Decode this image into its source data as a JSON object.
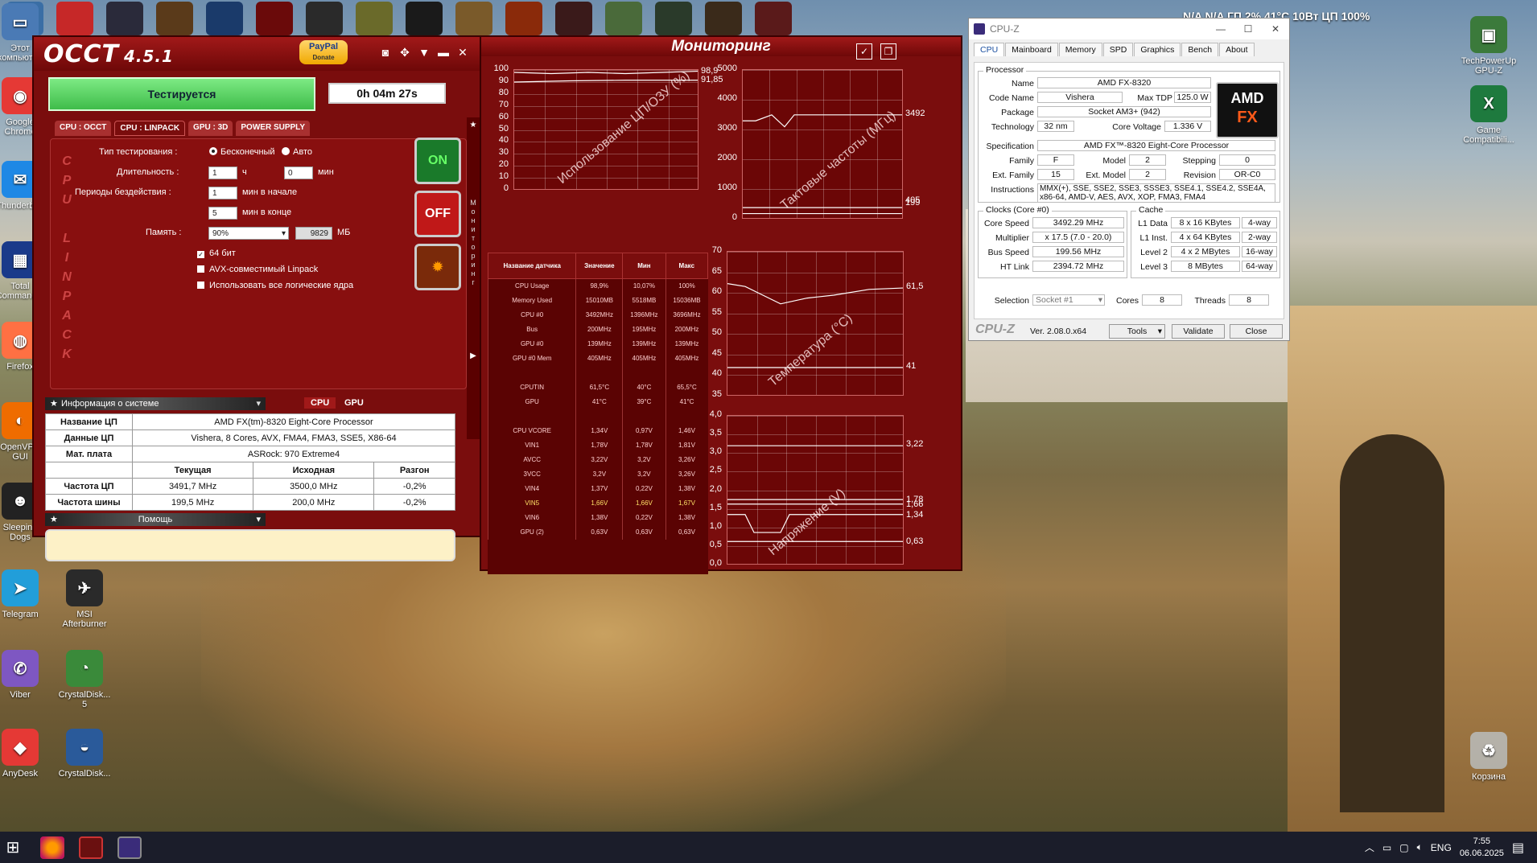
{
  "desktop": {
    "status_overlay": "N/A N/A  ГП 2% 41°C 10Вт  ЦП 100%",
    "left_icons": [
      {
        "name": "Этот компьютер",
        "label": "Этот компьютер"
      },
      {
        "name": "Google Chrome",
        "label": "Google Chrome"
      },
      {
        "name": "Thunderbird",
        "label": "Thunderbird"
      },
      {
        "name": "Total Commander",
        "label": "Total Commander"
      },
      {
        "name": "Firefox",
        "label": "Firefox"
      },
      {
        "name": "OpenVPN GUI",
        "label": "OpenVPN GUI"
      },
      {
        "name": "Sleeping Dogs",
        "label": "Sleeping Dogs"
      },
      {
        "name": "Telegram",
        "label": "Telegram"
      },
      {
        "name": "MSI Afterburner",
        "label": "MSI Afterburner"
      },
      {
        "name": "Viber",
        "label": "Viber"
      },
      {
        "name": "CrystalDiskInfo",
        "label": "CrystalDisk... 5"
      },
      {
        "name": "AnyDesk",
        "label": "AnyDesk"
      },
      {
        "name": "CrystalDiskMark",
        "label": "CrystalDisk..."
      }
    ],
    "right_icons": [
      {
        "label": "TechPowerUp GPU-Z"
      },
      {
        "label": "Game Compatibili..."
      },
      {
        "label": "Корзина"
      }
    ]
  },
  "occt": {
    "title": "OCCT",
    "version": "4.5.1",
    "paypal": "PayPal",
    "donate": "Donate",
    "status_button": "Тестируется",
    "timer": "0h 04m 27s",
    "tabs": [
      "CPU : OCCT",
      "CPU : LINPACK",
      "GPU : 3D",
      "POWER SUPPLY"
    ],
    "vertical_letters": [
      "C",
      "P",
      "U",
      "",
      "L",
      "I",
      "N",
      "P",
      "A",
      "C",
      "K"
    ],
    "test_type_label": "Тип тестирования :",
    "test_type_options": [
      "Бесконечный",
      "Авто"
    ],
    "duration_label": "Длительность :",
    "duration_hours": "1",
    "hours_unit": "ч",
    "duration_minutes": "0",
    "minutes_unit": "мин",
    "idle_label": "Периоды бездействия :",
    "idle_start": "1",
    "idle_start_unit": "мин в начале",
    "idle_end": "5",
    "idle_end_unit": "мин в конце",
    "memory_label": "Память :",
    "memory_value": "90%",
    "memory_mb": "9829",
    "memory_unit": "МБ",
    "options": [
      {
        "label": "64 бит",
        "checked": true
      },
      {
        "label": "AVX-совместимый Linpack",
        "checked": false
      },
      {
        "label": "Использовать все логические ядра",
        "checked": false
      }
    ],
    "on_label": "ON",
    "off_label": "OFF",
    "side_letters": [
      "М",
      "о",
      "н",
      "и",
      "т",
      "о",
      "р",
      "и",
      "н",
      "г"
    ],
    "sysinfo_title": "Информация о системе",
    "cpu_tab": "CPU",
    "gpu_tab": "GPU",
    "sysinfo_rows": [
      {
        "key": "Название ЦП",
        "value": "AMD FX(tm)-8320 Eight-Core Processor"
      },
      {
        "key": "Данные ЦП",
        "value": "Vishera, 8 Cores, AVX, FMA4, FMA3, SSE5, X86-64"
      },
      {
        "key": "Мат. плата",
        "value": "ASRock: 970 Extreme4"
      }
    ],
    "freq_headers": [
      "Текущая",
      "Исходная",
      "Разгон"
    ],
    "freq_rows": [
      {
        "key": "Частота ЦП",
        "cur": "3491,7 MHz",
        "base": "3500,0 MHz",
        "oc": "-0,2%"
      },
      {
        "key": "Частота шины",
        "cur": "199,5 MHz",
        "base": "200,0 MHz",
        "oc": "-0,2%"
      }
    ],
    "help_title": "Помощь"
  },
  "monitor": {
    "title": "Мониторинг",
    "usage_graph": {
      "title": "Использование ЦП/ОЗУ (%)",
      "ticks": [
        "100",
        "90",
        "80",
        "70",
        "60",
        "50",
        "40",
        "30",
        "20",
        "10",
        "0"
      ],
      "end_values": [
        "98,9",
        "91,85"
      ]
    },
    "clock_graph": {
      "title": "Тактовые частоты (МГц)",
      "ticks": [
        "5000",
        "4000",
        "3000",
        "2000",
        "1000",
        "0"
      ],
      "end_values": [
        "3492",
        "405",
        "199"
      ]
    },
    "temp_graph": {
      "title": "Температура (°C)",
      "ticks": [
        "70",
        "65",
        "60",
        "55",
        "50",
        "45",
        "40",
        "35"
      ],
      "end_values": [
        "61,5",
        "41"
      ]
    },
    "volt_graph": {
      "title": "Напряжение (V)",
      "ticks": [
        "4,0",
        "3,5",
        "3,0",
        "2,5",
        "2,0",
        "1,5",
        "1,0",
        "0,5",
        "0,0"
      ],
      "end_values": [
        "3,22",
        "1,78",
        "1,66",
        "1,34",
        "0,63"
      ]
    },
    "sensor_headers": [
      "Название датчика",
      "Значение",
      "Мин",
      "Макс"
    ],
    "sensor_rows": [
      {
        "name": "CPU Usage",
        "val": "98,9%",
        "min": "10,07%",
        "max": "100%",
        "y": false
      },
      {
        "name": "Memory Used",
        "val": "15010MB",
        "min": "5518MB",
        "max": "15036MB",
        "y": false
      },
      {
        "name": "CPU #0",
        "val": "3492MHz",
        "min": "1396MHz",
        "max": "3696MHz",
        "y": false
      },
      {
        "name": "Bus",
        "val": "200MHz",
        "min": "195MHz",
        "max": "200MHz",
        "y": false
      },
      {
        "name": "GPU #0",
        "val": "139MHz",
        "min": "139MHz",
        "max": "139MHz",
        "y": false
      },
      {
        "name": "GPU #0 Mem",
        "val": "405MHz",
        "min": "405MHz",
        "max": "405MHz",
        "y": false
      },
      {
        "name": "",
        "val": "",
        "min": "",
        "max": "",
        "y": false
      },
      {
        "name": "CPUTIN",
        "val": "61,5°C",
        "min": "40°C",
        "max": "65,5°C",
        "y": false
      },
      {
        "name": "GPU",
        "val": "41°C",
        "min": "39°C",
        "max": "41°C",
        "y": false
      },
      {
        "name": "",
        "val": "",
        "min": "",
        "max": "",
        "y": false
      },
      {
        "name": "CPU VCORE",
        "val": "1,34V",
        "min": "0,97V",
        "max": "1,46V",
        "y": false
      },
      {
        "name": "VIN1",
        "val": "1,78V",
        "min": "1,78V",
        "max": "1,81V",
        "y": false
      },
      {
        "name": "AVCC",
        "val": "3,22V",
        "min": "3,2V",
        "max": "3,26V",
        "y": false
      },
      {
        "name": "3VCC",
        "val": "3,2V",
        "min": "3,2V",
        "max": "3,26V",
        "y": false
      },
      {
        "name": "VIN4",
        "val": "1,37V",
        "min": "0,22V",
        "max": "1,38V",
        "y": false
      },
      {
        "name": "VIN5",
        "val": "1,66V",
        "min": "1,66V",
        "max": "1,67V",
        "y": true
      },
      {
        "name": "VIN6",
        "val": "1,38V",
        "min": "0,22V",
        "max": "1,38V",
        "y": false
      },
      {
        "name": "GPU (2)",
        "val": "0,63V",
        "min": "0,63V",
        "max": "0,63V",
        "y": false
      }
    ]
  },
  "cpuz": {
    "title": "CPU-Z",
    "tabs": [
      "CPU",
      "Mainboard",
      "Memory",
      "SPD",
      "Graphics",
      "Bench",
      "About"
    ],
    "processor_group": "Processor",
    "name_label": "Name",
    "name": "AMD FX-8320",
    "codename_label": "Code Name",
    "codename": "Vishera",
    "maxtdp_label": "Max TDP",
    "maxtdp": "125.0 W",
    "package_label": "Package",
    "package": "Socket AM3+ (942)",
    "technology_label": "Technology",
    "technology": "32 nm",
    "corevoltage_label": "Core Voltage",
    "corevoltage": "1.336 V",
    "spec_label": "Specification",
    "spec": "AMD FX™-8320 Eight-Core Processor",
    "family_label": "Family",
    "family": "F",
    "model_label": "Model",
    "model": "2",
    "stepping_label": "Stepping",
    "stepping": "0",
    "extfamily_label": "Ext. Family",
    "extfamily": "15",
    "extmodel_label": "Ext. Model",
    "extmodel": "2",
    "revision_label": "Revision",
    "revision": "OR-C0",
    "instr_label": "Instructions",
    "instructions": "MMX(+), SSE, SSE2, SSE3, SSSE3, SSE4.1, SSE4.2, SSE4A, x86-64, AMD-V, AES, AVX, XOP, FMA3, FMA4",
    "clocks_group": "Clocks (Core #0)",
    "corespeed_label": "Core Speed",
    "corespeed": "3492.29 MHz",
    "multiplier_label": "Multiplier",
    "multiplier": "x 17.5 (7.0 - 20.0)",
    "busspeed_label": "Bus Speed",
    "busspeed": "199.56 MHz",
    "htlink_label": "HT Link",
    "htlink": "2394.72 MHz",
    "cache_group": "Cache",
    "l1d_label": "L1 Data",
    "l1d": "8 x 16 KBytes",
    "l1d_way": "4-way",
    "l1i_label": "L1 Inst.",
    "l1i": "4 x 64 KBytes",
    "l1i_way": "2-way",
    "l2_label": "Level 2",
    "l2": "4 x 2 MBytes",
    "l2_way": "16-way",
    "l3_label": "Level 3",
    "l3": "8 MBytes",
    "l3_way": "64-way",
    "selection_label": "Selection",
    "selection": "Socket #1",
    "cores_label": "Cores",
    "cores": "8",
    "threads_label": "Threads",
    "threads": "8",
    "brand": "CPU-Z",
    "version": "Ver. 2.08.0.x64",
    "tools": "Tools",
    "validate": "Validate",
    "close": "Close",
    "amd_logo": "AMD",
    "fx_logo": "FX"
  },
  "taskbar": {
    "lang": "ENG",
    "time": "7:55",
    "date": "06.06.2025"
  }
}
